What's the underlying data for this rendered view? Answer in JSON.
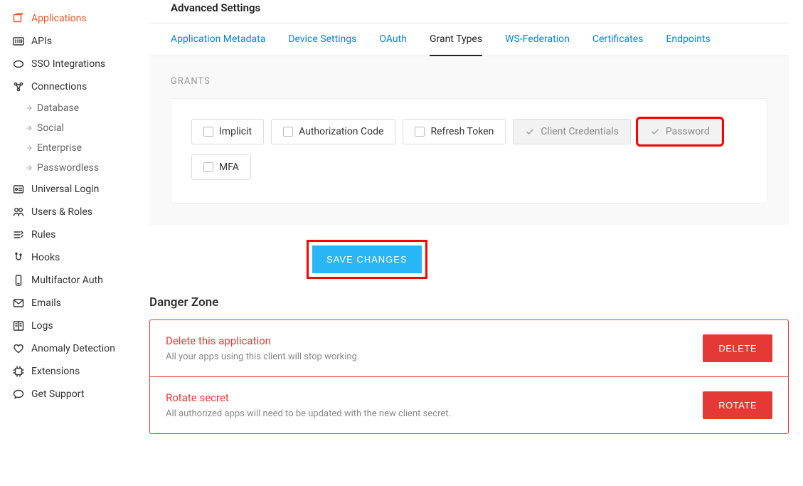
{
  "sidebar": {
    "items": [
      {
        "label": "Applications",
        "icon": "apps",
        "active": true
      },
      {
        "label": "APIs",
        "icon": "apis"
      },
      {
        "label": "SSO Integrations",
        "icon": "sso"
      },
      {
        "label": "Connections",
        "icon": "connections",
        "children": [
          {
            "label": "Database"
          },
          {
            "label": "Social"
          },
          {
            "label": "Enterprise"
          },
          {
            "label": "Passwordless"
          }
        ]
      },
      {
        "label": "Universal Login",
        "icon": "card"
      },
      {
        "label": "Users & Roles",
        "icon": "users"
      },
      {
        "label": "Rules",
        "icon": "rules"
      },
      {
        "label": "Hooks",
        "icon": "hooks"
      },
      {
        "label": "Multifactor Auth",
        "icon": "mfa"
      },
      {
        "label": "Emails",
        "icon": "email"
      },
      {
        "label": "Logs",
        "icon": "logs"
      },
      {
        "label": "Anomaly Detection",
        "icon": "heart"
      },
      {
        "label": "Extensions",
        "icon": "chip"
      },
      {
        "label": "Get Support",
        "icon": "chat"
      }
    ]
  },
  "section_title": "Advanced Settings",
  "tabs": [
    {
      "label": "Application Metadata"
    },
    {
      "label": "Device Settings"
    },
    {
      "label": "OAuth"
    },
    {
      "label": "Grant Types",
      "active": true
    },
    {
      "label": "WS-Federation"
    },
    {
      "label": "Certificates"
    },
    {
      "label": "Endpoints"
    }
  ],
  "grants": {
    "label": "GRANTS",
    "options": [
      {
        "label": "Implicit",
        "checked": false,
        "disabled": false
      },
      {
        "label": "Authorization Code",
        "checked": false,
        "disabled": false
      },
      {
        "label": "Refresh Token",
        "checked": false,
        "disabled": false
      },
      {
        "label": "Client Credentials",
        "checked": true,
        "disabled": true
      },
      {
        "label": "Password",
        "checked": true,
        "disabled": true,
        "highlight": true
      },
      {
        "label": "MFA",
        "checked": false,
        "disabled": false
      }
    ]
  },
  "save_label": "SAVE CHANGES",
  "danger": {
    "title": "Danger Zone",
    "items": [
      {
        "heading": "Delete this application",
        "desc": "All your apps using this client will stop working.",
        "button": "DELETE"
      },
      {
        "heading": "Rotate secret",
        "desc": "All authorized apps will need to be updated with the new client secret.",
        "button": "ROTATE"
      }
    ]
  }
}
